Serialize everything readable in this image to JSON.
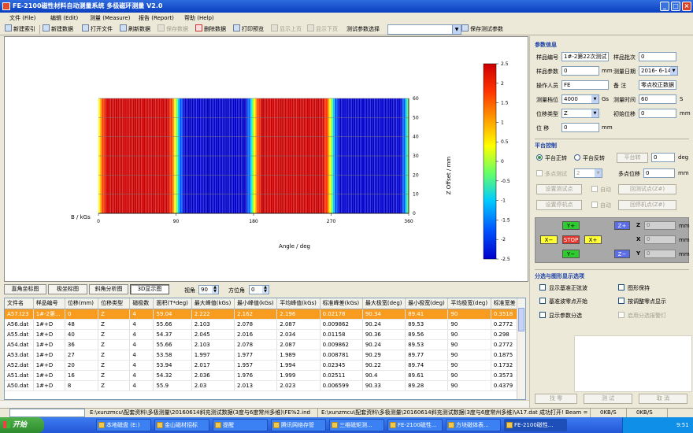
{
  "window": {
    "title": "FE-2100磁性材料自动测量系统   多极磁环测量  V2.0"
  },
  "menu": [
    "文件 (File)",
    "编辑 (Edit)",
    "测量 (Measure)",
    "报告 (Report)",
    "帮助 (Help)"
  ],
  "toolbar": {
    "buttons": [
      {
        "label": "新建索引",
        "enabled": true
      },
      {
        "label": "新建数据",
        "enabled": true
      },
      {
        "label": "打开文件",
        "enabled": true
      },
      {
        "label": "刷新数据",
        "enabled": true
      },
      {
        "label": "保存数据",
        "enabled": false
      },
      {
        "label": "删除数据",
        "enabled": true
      },
      {
        "label": "打印预览",
        "enabled": true
      },
      {
        "label": "显示上页",
        "enabled": false
      },
      {
        "label": "显示下页",
        "enabled": false
      },
      {
        "label": "测试参数选择",
        "enabled": true
      }
    ],
    "save_params": "保存测试参数"
  },
  "chart_data": {
    "type": "heatmap",
    "xlabel": "Angle / deg",
    "ylabel": "Z Offset / mm",
    "left_axis_label": "B / kGs",
    "x_ticks": [
      0,
      90,
      180,
      270,
      360
    ],
    "y_ticks": [
      0,
      10,
      20,
      30,
      40,
      50,
      60
    ],
    "xlim": [
      0,
      360
    ],
    "ylim": [
      0,
      60
    ],
    "colorbar_ticks": [
      2.5,
      2,
      1.5,
      1,
      0.5,
      0,
      -0.5,
      -1,
      -1.5,
      -2,
      -2.5
    ],
    "colorbar_range": [
      -2.5,
      2.5
    ],
    "pole_count": 4,
    "amplitude_kGs": 2.2,
    "colormap": [
      "#cc0000",
      "#ff3300",
      "#ff9900",
      "#ffff00",
      "#66ff66",
      "#00ccff",
      "#0055ff",
      "#0000cc"
    ]
  },
  "view_tabs": [
    "直角坐标图",
    "极坐标图",
    "斜角分析图",
    "3D显示图"
  ],
  "active_tab": "3D显示图",
  "view": {
    "angle_label": "视角",
    "angle_value": "90",
    "azimuth_label": "方位角",
    "azimuth_value": "0"
  },
  "table": {
    "columns": [
      "文件名",
      "样品编号",
      "位移(mm)",
      "位移类型",
      "磁极数",
      "面积(T*deg)",
      "最大峰值(kGs)",
      "最小峰值(kGs)",
      "平均峰值(kGs)",
      "标准峰差(kGs)",
      "最大极宽(deg)",
      "最小极宽(deg)",
      "平均极宽(deg)",
      "标准宽差"
    ],
    "rows": [
      [
        "A57.t23",
        "1#-2第...",
        "0",
        "Z",
        "4",
        "59.04",
        "2.222",
        "2.162",
        "2.196",
        "0.02178",
        "90.34",
        "89.41",
        "90",
        "0.3518"
      ],
      [
        "A56.dat",
        "1#+D",
        "48",
        "Z",
        "4",
        "55.66",
        "2.103",
        "2.078",
        "2.087",
        "0.009862",
        "90.24",
        "89.53",
        "90",
        "0.2772"
      ],
      [
        "A55.dat",
        "1#+D",
        "40",
        "Z",
        "4",
        "54.37",
        "2.045",
        "2.016",
        "2.034",
        "0.01158",
        "90.36",
        "89.56",
        "90",
        "0.298"
      ],
      [
        "A54.dat",
        "1#+D",
        "36",
        "Z",
        "4",
        "55.66",
        "2.103",
        "2.078",
        "2.087",
        "0.009862",
        "90.24",
        "89.53",
        "90",
        "0.2772"
      ],
      [
        "A53.dat",
        "1#+D",
        "27",
        "Z",
        "4",
        "53.58",
        "1.997",
        "1.977",
        "1.989",
        "0.008781",
        "90.29",
        "89.77",
        "90",
        "0.1875"
      ],
      [
        "A52.dat",
        "1#+D",
        "20",
        "Z",
        "4",
        "53.94",
        "2.017",
        "1.957",
        "1.994",
        "0.02345",
        "90.22",
        "89.74",
        "90",
        "0.1732"
      ],
      [
        "A51.dat",
        "1#+D",
        "16",
        "Z",
        "4",
        "54.32",
        "2.036",
        "1.976",
        "1.999",
        "0.02511",
        "90.4",
        "89.61",
        "90",
        "0.3573"
      ],
      [
        "A50.dat",
        "1#+D",
        "8",
        "Z",
        "4",
        "55.9",
        "2.03",
        "2.013",
        "2.023",
        "0.006599",
        "90.33",
        "89.28",
        "90",
        "0.4379"
      ]
    ]
  },
  "params": {
    "section": "参数信息",
    "sample_no_label": "样品编号",
    "sample_no": "1#-2第22次测试",
    "batch_label": "样品批次",
    "batch": "0",
    "sample_param_label": "样品参数",
    "sample_param": "0",
    "sample_param_unit": "mm",
    "date_label": "测量日期",
    "date": "2016- 6-14",
    "operator_label": "操作人员",
    "operator": "FE",
    "remark_label": "备    注",
    "remark": "零点校正数据",
    "range_label": "测量档位",
    "range": "4000",
    "range_unit": "Gs",
    "time_label": "测量时间",
    "time": "60",
    "time_unit": "S",
    "disp_type_label": "位移类型",
    "disp_type": "Z",
    "init_disp_label": "初始位移",
    "init_disp": "0",
    "init_disp_unit": "mm",
    "disp_label": "位    移",
    "disp": "0",
    "disp_unit": "mm"
  },
  "platform": {
    "section": "平台控制",
    "rot_forward": "平台正转",
    "rot_reverse": "平台反转",
    "rotate_btn": "平台转",
    "rotate_value": "0",
    "rotate_unit": "deg",
    "multipoint_label": "多点测试",
    "multipoint_value": "2",
    "multi_disp_label": "多点位移",
    "multi_disp_value": "0",
    "multi_disp_unit": "mm",
    "set_test_point": "设置测试点",
    "auto1": "自动",
    "return_test_point": "回测试点(Z#)",
    "set_stop_point": "设置停机点",
    "auto2": "自动",
    "return_stop_point": "回停机点(Z#)",
    "keys": {
      "y_plus": "Y+",
      "y_minus": "Y−",
      "x_plus": "X+",
      "x_minus": "X−",
      "stop": "STOP",
      "z_plus": "Z+",
      "z_minus": "Z−"
    },
    "axes": {
      "z": "Z",
      "x": "X",
      "y": "Y"
    },
    "pos": {
      "z": "0",
      "x": "0",
      "y": "0",
      "unit": "mm"
    }
  },
  "options": {
    "section": "分选与图形显示选项",
    "opt1": "显示基准正弦波",
    "opt2": "图形保持",
    "opt3": "基准波零点开始",
    "opt4": "按调整零点显示",
    "opt5": "显示参数分选",
    "opt6": "启用分选报警灯"
  },
  "bottom_buttons": {
    "zero": "找  零",
    "test": "测  试",
    "cancel": "取  消"
  },
  "status": {
    "path1": "E:\\xunzmcu\\配套资料\\多极测量\\20160614斜充测试数据(3度与6度常州多维)\\FE%2.ind",
    "path2": "E:\\xunzmcu\\配套资料\\多极测量\\20160614斜充测试数据(3度与6度常州多维)\\A17.dat 成功打开! Beam = 1",
    "speed1": "0KB/S",
    "speed2": "0KB/S"
  },
  "taskbar": {
    "start": "开始",
    "tasks": [
      "本地磁盘 (E:)",
      "金山磁材招标",
      "提醒",
      "腾讯网络存管",
      "三维磁矩测...",
      "FE-2100磁性...",
      "方块磁体表...",
      "FE-2100磁性..."
    ],
    "clock": "9:51"
  }
}
